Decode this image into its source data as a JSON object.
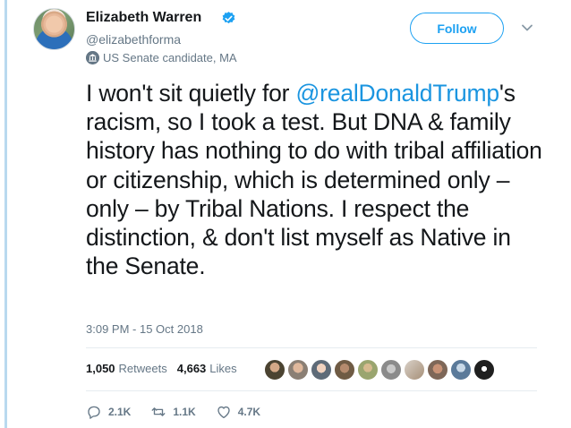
{
  "author": {
    "name": "Elizabeth Warren",
    "handle": "@elizabethforma",
    "label": "US Senate candidate, MA"
  },
  "follow_button": {
    "label": "Follow"
  },
  "tweet": {
    "mention": "@realDonaldTrump",
    "text_before": "I won't sit quietly for ",
    "text_after": "'s racism, so I took a test. But DNA & family history has nothing to do with tribal affiliation or citizenship, which is determined only – only – by Tribal Nations. I respect the distinction, & don't list myself as Native in the Senate.",
    "timestamp": "3:09 PM - 15 Oct 2018"
  },
  "stats": {
    "retweets_count": "1,050",
    "retweets_label": "Retweets",
    "likes_count": "4,663",
    "likes_label": "Likes"
  },
  "actions": {
    "replies": "2.1K",
    "retweets": "1.1K",
    "likes": "4.7K"
  },
  "icons": {
    "verified": "verified-badge-icon",
    "label": "government-building-icon",
    "menu": "chevron-down-icon",
    "reply": "reply-icon",
    "retweet": "retweet-icon",
    "like": "heart-icon"
  },
  "colors": {
    "accent": "#1da1f2",
    "link": "#1b95e0",
    "text": "#14171a",
    "muted": "#657786",
    "thread_line": "#b9d9ef"
  }
}
